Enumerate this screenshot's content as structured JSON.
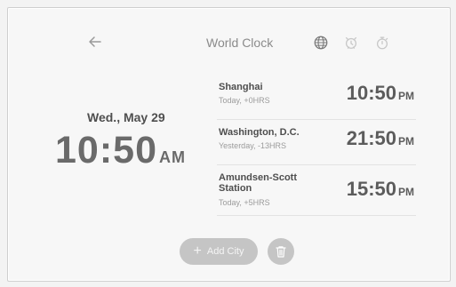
{
  "header": {
    "title": "World Clock",
    "back_icon": "back-arrow-icon",
    "icons": [
      "globe-icon",
      "alarm-icon",
      "stopwatch-icon"
    ]
  },
  "local": {
    "date": "Wed., May 29",
    "time": "10:50",
    "ampm": "AM"
  },
  "cities": [
    {
      "name": "Shanghai",
      "offset": "Today, +0HRS",
      "time": "10:50",
      "ampm": "PM"
    },
    {
      "name": "Washington, D.C.",
      "offset": "Yesterday, -13HRS",
      "time": "21:50",
      "ampm": "PM"
    },
    {
      "name": "Amundsen-Scott Station",
      "offset": "Today, +5HRS",
      "time": "15:50",
      "ampm": "PM"
    }
  ],
  "actions": {
    "add_city_label": "Add City",
    "delete_icon": "trash-icon"
  },
  "colors": {
    "background": "#f7f7f7",
    "button_gray": "#c5c5c5",
    "text_dark": "#5c5c5c"
  }
}
